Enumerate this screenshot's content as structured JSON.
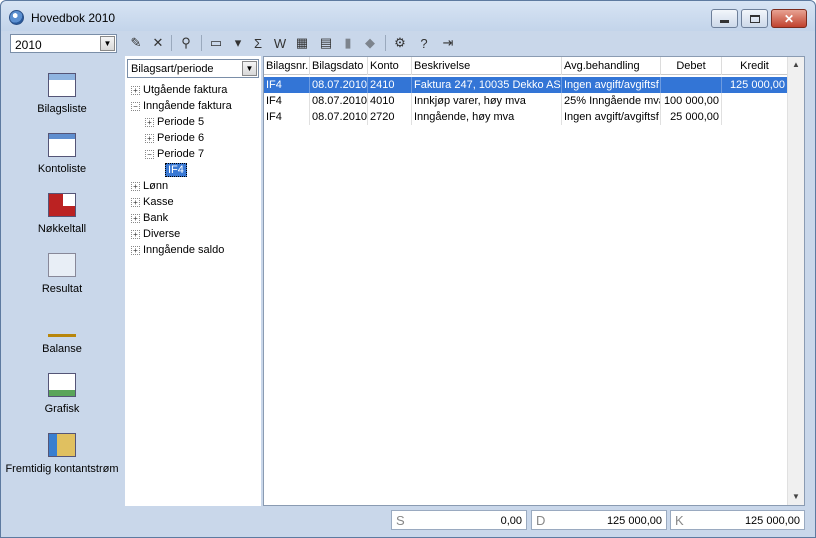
{
  "window": {
    "title": "Hovedbok 2010"
  },
  "year_select": {
    "value": "2010"
  },
  "toolbar": {
    "buttons": [
      {
        "icon": "edit-icon",
        "glyph": "✎"
      },
      {
        "icon": "delete-icon",
        "glyph": "✕"
      },
      {
        "icon": "search-icon",
        "glyph": "⚲"
      },
      {
        "icon": "document-icon",
        "glyph": "▭"
      },
      {
        "icon": "dropdown-arrow-icon",
        "glyph": "▾"
      },
      {
        "icon": "sum-icon",
        "glyph": "Σ"
      },
      {
        "icon": "word-export-icon",
        "glyph": "W"
      },
      {
        "icon": "excel-export-icon",
        "glyph": "▦"
      },
      {
        "icon": "card-icon",
        "glyph": "▤"
      },
      {
        "icon": "page-icon",
        "glyph": "▮"
      },
      {
        "icon": "chat-icon",
        "glyph": "◆"
      },
      {
        "icon": "settings-icon",
        "glyph": "⚙"
      },
      {
        "icon": "help-icon",
        "glyph": "?"
      },
      {
        "icon": "exit-icon",
        "glyph": "⇥"
      }
    ]
  },
  "sidebar": {
    "items": [
      {
        "label": "Bilagsliste",
        "icon": "voucher-list-icon"
      },
      {
        "label": "Kontoliste",
        "icon": "account-list-icon"
      },
      {
        "label": "Nøkkeltall",
        "icon": "key-figures-icon"
      },
      {
        "label": "Resultat",
        "icon": "result-icon"
      },
      {
        "label": "Balanse",
        "icon": "balance-icon"
      },
      {
        "label": "Grafisk",
        "icon": "graph-icon"
      },
      {
        "label": "Fremtidig kontantstrøm",
        "icon": "cashflow-icon"
      }
    ]
  },
  "tree": {
    "select_value": "Bilagsart/periode",
    "nodes": [
      {
        "label": "Utgående faktura",
        "level": 0,
        "expander": "+"
      },
      {
        "label": "Inngående faktura",
        "level": 0,
        "expander": "−"
      },
      {
        "label": "Periode 5",
        "level": 1,
        "expander": "+"
      },
      {
        "label": "Periode 6",
        "level": 1,
        "expander": "+"
      },
      {
        "label": "Periode 7",
        "level": 1,
        "expander": "−"
      },
      {
        "label": "IF4",
        "level": 2,
        "expander": "",
        "selected": true
      },
      {
        "label": "Lønn",
        "level": 0,
        "expander": "+"
      },
      {
        "label": "Kasse",
        "level": 0,
        "expander": "+"
      },
      {
        "label": "Bank",
        "level": 0,
        "expander": "+"
      },
      {
        "label": "Diverse",
        "level": 0,
        "expander": "+"
      },
      {
        "label": "Inngående saldo",
        "level": 0,
        "expander": "+"
      }
    ]
  },
  "grid": {
    "columns": [
      "Bilagsnr.",
      "Bilagsdato",
      "Konto",
      "Beskrivelse",
      "Avg.behandling",
      "Debet",
      "Kredit"
    ],
    "rows": [
      [
        "IF4",
        "08.07.2010",
        "2410",
        "Faktura 247, 10035 Dekko AS",
        "Ingen avgift/avgiftsf",
        "",
        "125 000,00"
      ],
      [
        "IF4",
        "08.07.2010",
        "4010",
        "Innkjøp varer, høy mva",
        "25% Inngående mva",
        "100 000,00",
        ""
      ],
      [
        "IF4",
        "08.07.2010",
        "2720",
        "Inngående, høy mva",
        "Ingen avgift/avgiftsf",
        "25 000,00",
        ""
      ]
    ],
    "selected_row": 0
  },
  "totals": {
    "s_label": "S",
    "s_value": "0,00",
    "d_label": "D",
    "d_value": "125 000,00",
    "k_label": "K",
    "k_value": "125 000,00"
  },
  "colors": {
    "selection": "#3375d6",
    "frame": "#c9d7ea"
  }
}
